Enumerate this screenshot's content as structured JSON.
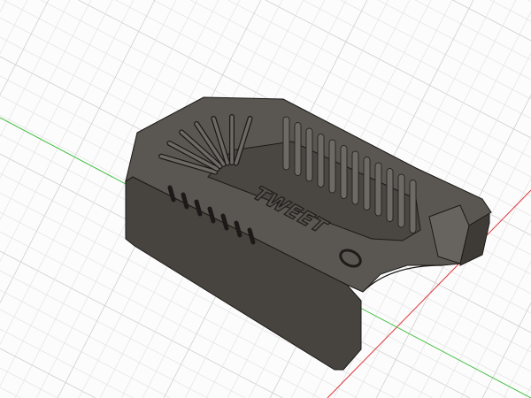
{
  "viewport": {
    "colors": {
      "background": "#fcfcfc",
      "grid_minor": "#e4e4e4",
      "grid_major": "#cfcfcf",
      "x_axis": "#e0383c",
      "y_axis": "#4cc24c",
      "model_top": "#5a5651",
      "model_side": "#47433f",
      "model_edge": "#1c1a18"
    }
  },
  "model": {
    "embossed_text": "TWEET"
  }
}
